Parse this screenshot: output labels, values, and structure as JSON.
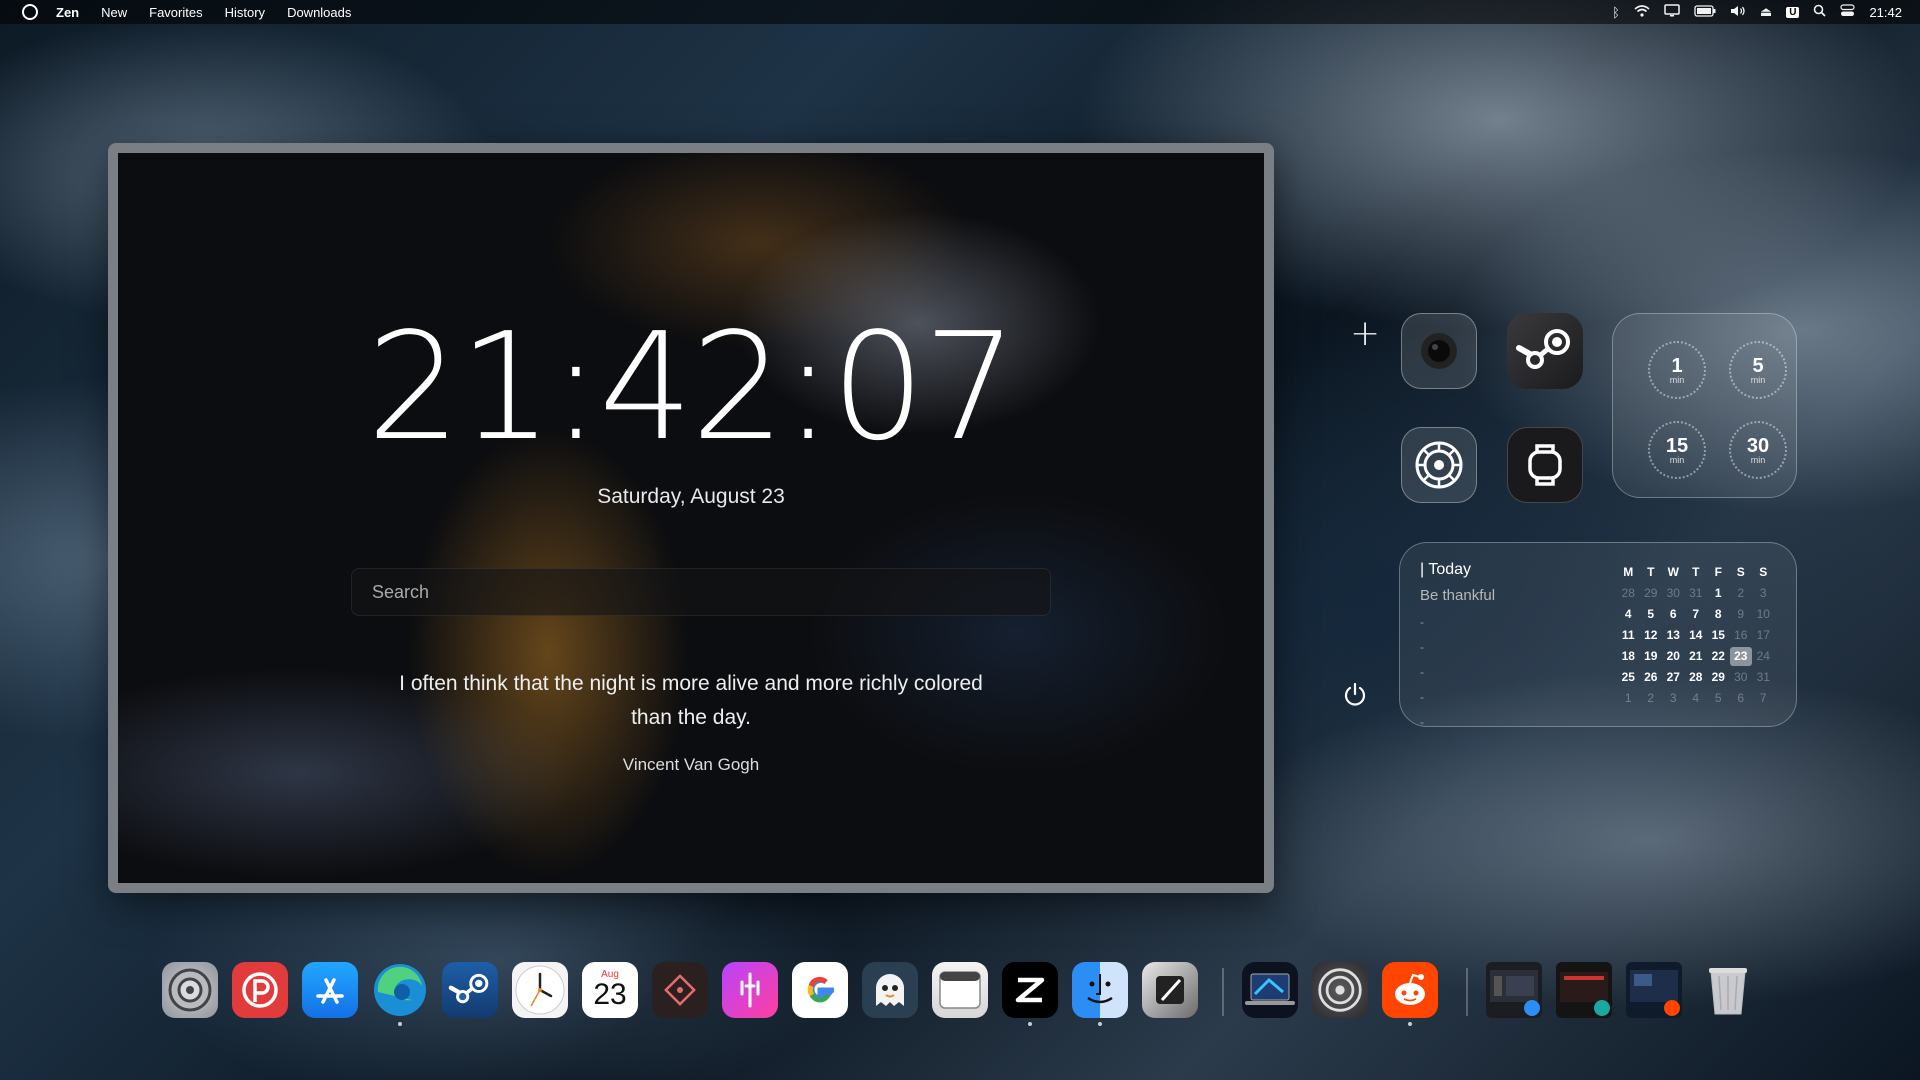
{
  "menubar": {
    "app": "Zen",
    "items": [
      "New",
      "Favorites",
      "History",
      "Downloads"
    ],
    "time": "21:42",
    "badge": "U"
  },
  "newtab": {
    "clock": "21:42:07",
    "date": "Saturday, August 23",
    "search_placeholder": "Search",
    "quote": "I often think that the night is more alive and more richly colored than the day.",
    "author": "Vincent Van Gogh"
  },
  "timers": [
    {
      "value": "1",
      "unit": "min"
    },
    {
      "value": "5",
      "unit": "min"
    },
    {
      "value": "15",
      "unit": "min"
    },
    {
      "value": "30",
      "unit": "min"
    }
  ],
  "calendar": {
    "title": "| Today",
    "note": "Be thankful",
    "dashes": [
      "-",
      "-",
      "-",
      "-",
      "-"
    ],
    "headers": [
      "M",
      "T",
      "W",
      "T",
      "F",
      "S",
      "S"
    ],
    "weeks": [
      [
        "28",
        "29",
        "30",
        "31",
        "1",
        "2",
        "3"
      ],
      [
        "4",
        "5",
        "6",
        "7",
        "8",
        "9",
        "10"
      ],
      [
        "11",
        "12",
        "13",
        "14",
        "15",
        "16",
        "17"
      ],
      [
        "18",
        "19",
        "20",
        "21",
        "22",
        "23",
        "24"
      ],
      [
        "25",
        "26",
        "27",
        "28",
        "29",
        "30",
        "31"
      ],
      [
        "1",
        "2",
        "3",
        "4",
        "5",
        "6",
        "7"
      ]
    ],
    "selected": "23"
  },
  "dock": {
    "calendar_month": "Aug",
    "calendar_day": "23"
  },
  "colors": {
    "pdf_red": "#e23b3b",
    "appstore_blue": "#1d8cf8",
    "edge_teal": "#1ba8a0",
    "steam_blue": "#1b4a8a",
    "reddit_orange": "#ff4500",
    "finder_blue": "#2c8ef5"
  }
}
